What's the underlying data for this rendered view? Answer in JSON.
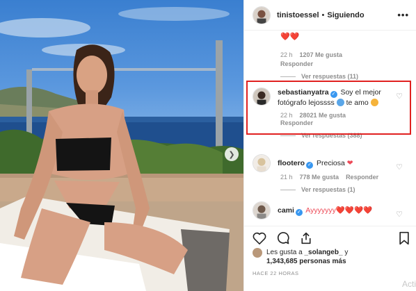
{
  "post": {
    "owner_username": "tinistoessel",
    "follow_status": "Siguiendo",
    "separator": "•",
    "more_label": "•••"
  },
  "comments_partial": "❤️❤️",
  "comments": [
    {
      "username": "",
      "text": "",
      "time": "22 h",
      "likes": "1207 Me gusta",
      "reply_label": "Responder",
      "view_replies": "Ver respuestas (11)"
    },
    {
      "username": "sebastianyatra",
      "text": "Soy el mejor fotógrafo lejossss",
      "text_suffix": "te amo",
      "time": "22 h",
      "likes": "28021 Me gusta",
      "reply_label": "Responder",
      "view_replies": "Ver respuestas (388)"
    },
    {
      "username": "flootero",
      "text": "Preciosa",
      "time": "21 h",
      "likes": "778 Me gusta",
      "reply_label": "Responder",
      "view_replies": "Ver respuestas (1)"
    },
    {
      "username": "cami",
      "text": "Ayyyyyyy❤️❤️❤️❤️"
    }
  ],
  "likes_summary": {
    "prefix": "Les gusta a",
    "user": "_solangeb_",
    "connector": "y",
    "count": "1,343,685 personas más"
  },
  "timestamp": "HACE 22 HORAS",
  "watermark": "Acti",
  "icons": {
    "like": "heart-icon",
    "comment": "comment-icon",
    "share": "share-icon",
    "save": "bookmark-icon",
    "next": "chevron-right-icon"
  },
  "colors": {
    "verified": "#3897f0",
    "highlight": "#e0201f",
    "meta": "#8e8e8e"
  }
}
